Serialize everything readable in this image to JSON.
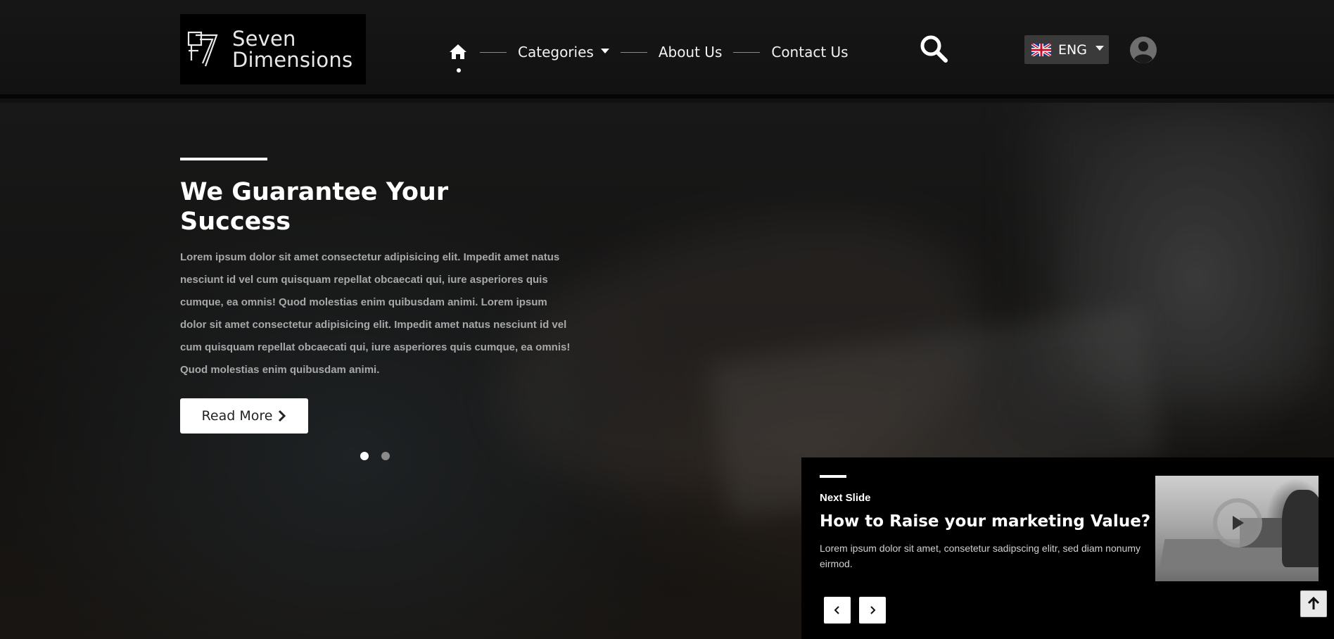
{
  "header": {
    "logo": {
      "line1": "Seven",
      "line2": "Dimensions"
    },
    "nav": {
      "home_icon": "home-icon",
      "items": [
        {
          "label": "Categories",
          "has_dropdown": true
        },
        {
          "label": "About Us"
        },
        {
          "label": "Contact Us"
        }
      ]
    },
    "search_icon": "search-icon",
    "language": {
      "label": "ENG",
      "flag": "uk-flag-icon"
    },
    "user_icon": "user-avatar-icon"
  },
  "hero": {
    "title": "We Guarantee Your Success",
    "body": "Lorem ipsum dolor sit amet consectetur adipisicing elit. Impedit amet natus nesciunt id vel cum quisquam repellat obcaecati qui, iure asperiores quis cumque, ea omnis! Quod molestias enim quibusdam animi. Lorem ipsum dolor sit amet consectetur adipisicing elit. Impedit amet natus nesciunt id vel cum quisquam repellat obcaecati qui, iure asperiores quis cumque, ea omnis! Quod molestias enim quibusdam animi.",
    "button_label": "Read More",
    "slide_count": 2,
    "active_slide": 1
  },
  "next_slide": {
    "label": "Next Slide",
    "title": "How to Raise your marketing Value?",
    "body": "Lorem ipsum dolor sit amet, consetetur sadipscing elitr, sed diam nonumy eirmod.",
    "play_icon": "play-icon",
    "prev_icon": "chevron-left-icon",
    "next_icon": "chevron-right-icon"
  },
  "scroll_top_icon": "arrow-up-icon",
  "colors": {
    "background": "#121212",
    "panel": "#000000",
    "accent": "#ffffff",
    "muted_text": "#a8a8a8"
  }
}
